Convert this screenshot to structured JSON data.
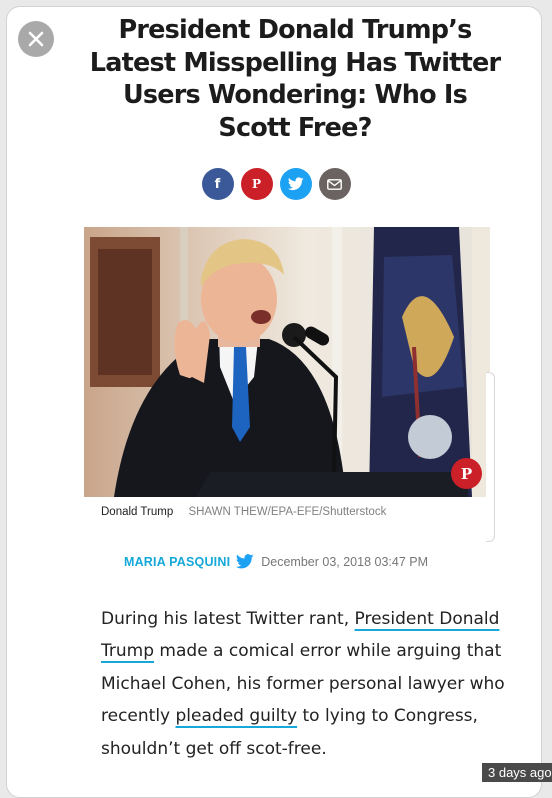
{
  "article": {
    "close_icon": "close-icon",
    "headline": "President Donald Trump’s Latest Misspelling Has Twitter Users Wondering: Who Is Scott Free?",
    "share": [
      {
        "name": "facebook",
        "label": "f",
        "color": "#3b5998"
      },
      {
        "name": "pinterest",
        "label": "P",
        "color": "#cb2027"
      },
      {
        "name": "twitter",
        "label": "",
        "color": "#1da1f2"
      },
      {
        "name": "email",
        "label": "",
        "color": "#6b6362"
      }
    ],
    "photo_alt": "Donald Trump speaking at a podium",
    "pin_label": "P",
    "caption": {
      "subject": "Donald Trump",
      "credit": "SHAWN THEW/EPA-EFE/Shutterstock"
    },
    "byline": {
      "author": "MARIA PASQUINI",
      "date": "December 03, 2018 03:47 PM"
    },
    "body": {
      "part1": "During his latest Twitter rant, ",
      "link1": "President Donald Trump",
      "part2": " made a comical error while arguing that Michael Cohen, his former personal lawyer who recently ",
      "link2": "pleaded guilty",
      "part3": " to lying to Congress, shouldn’t get off scot-free."
    },
    "timestamp_badge": "3 days ago"
  },
  "colors": {
    "accent": "#15a8d8",
    "close_bg": "#a9a9a9",
    "pin_red": "#cb2027"
  }
}
